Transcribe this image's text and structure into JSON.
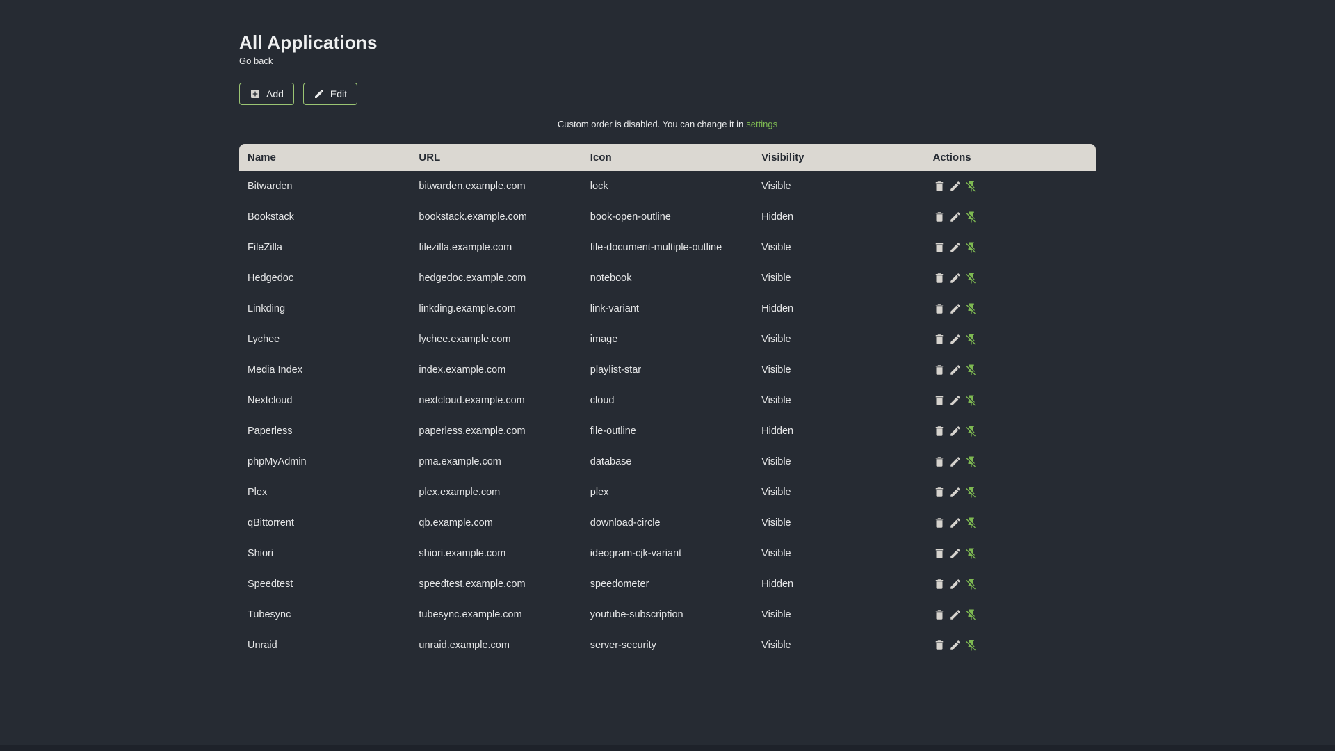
{
  "page": {
    "title": "All Applications",
    "back_link_label": "Go back",
    "notice_text": "Custom order is disabled. You can change it in",
    "notice_link_label": "settings"
  },
  "toolbar": {
    "add_label": "Add",
    "edit_label": "Edit",
    "add_icon": "plus-box-icon",
    "edit_icon": "pencil-icon"
  },
  "table": {
    "columns": [
      "Name",
      "URL",
      "Icon",
      "Visibility",
      "Actions"
    ],
    "action_icons": [
      "delete-icon",
      "edit-icon",
      "pin-off-icon"
    ],
    "rows": [
      {
        "name": "Bitwarden",
        "url": "bitwarden.example.com",
        "icon": "lock",
        "visibility": "Visible"
      },
      {
        "name": "Bookstack",
        "url": "bookstack.example.com",
        "icon": "book-open-outline",
        "visibility": "Hidden"
      },
      {
        "name": "FileZilla",
        "url": "filezilla.example.com",
        "icon": "file-document-multiple-outline",
        "visibility": "Visible"
      },
      {
        "name": "Hedgedoc",
        "url": "hedgedoc.example.com",
        "icon": "notebook",
        "visibility": "Visible"
      },
      {
        "name": "Linkding",
        "url": "linkding.example.com",
        "icon": "link-variant",
        "visibility": "Hidden"
      },
      {
        "name": "Lychee",
        "url": "lychee.example.com",
        "icon": "image",
        "visibility": "Visible"
      },
      {
        "name": "Media Index",
        "url": "index.example.com",
        "icon": "playlist-star",
        "visibility": "Visible"
      },
      {
        "name": "Nextcloud",
        "url": "nextcloud.example.com",
        "icon": "cloud",
        "visibility": "Visible"
      },
      {
        "name": "Paperless",
        "url": "paperless.example.com",
        "icon": "file-outline",
        "visibility": "Hidden"
      },
      {
        "name": "phpMyAdmin",
        "url": "pma.example.com",
        "icon": "database",
        "visibility": "Visible"
      },
      {
        "name": "Plex",
        "url": "plex.example.com",
        "icon": "plex",
        "visibility": "Visible"
      },
      {
        "name": "qBittorrent",
        "url": "qb.example.com",
        "icon": "download-circle",
        "visibility": "Visible"
      },
      {
        "name": "Shiori",
        "url": "shiori.example.com",
        "icon": "ideogram-cjk-variant",
        "visibility": "Visible"
      },
      {
        "name": "Speedtest",
        "url": "speedtest.example.com",
        "icon": "speedometer",
        "visibility": "Hidden"
      },
      {
        "name": "Tubesync",
        "url": "tubesync.example.com",
        "icon": "youtube-subscription",
        "visibility": "Visible"
      },
      {
        "name": "Unraid",
        "url": "unraid.example.com",
        "icon": "server-security",
        "visibility": "Visible"
      }
    ]
  },
  "colors": {
    "background": "#262b33",
    "accent_green": "#7eb952",
    "button_border": "#9bc573",
    "table_header_bg": "#dbd8d2",
    "table_header_text": "#262b33",
    "body_text": "#e4e5e6",
    "icon_gray": "#d6d3ce",
    "bottom_edge": "#1e222a"
  }
}
